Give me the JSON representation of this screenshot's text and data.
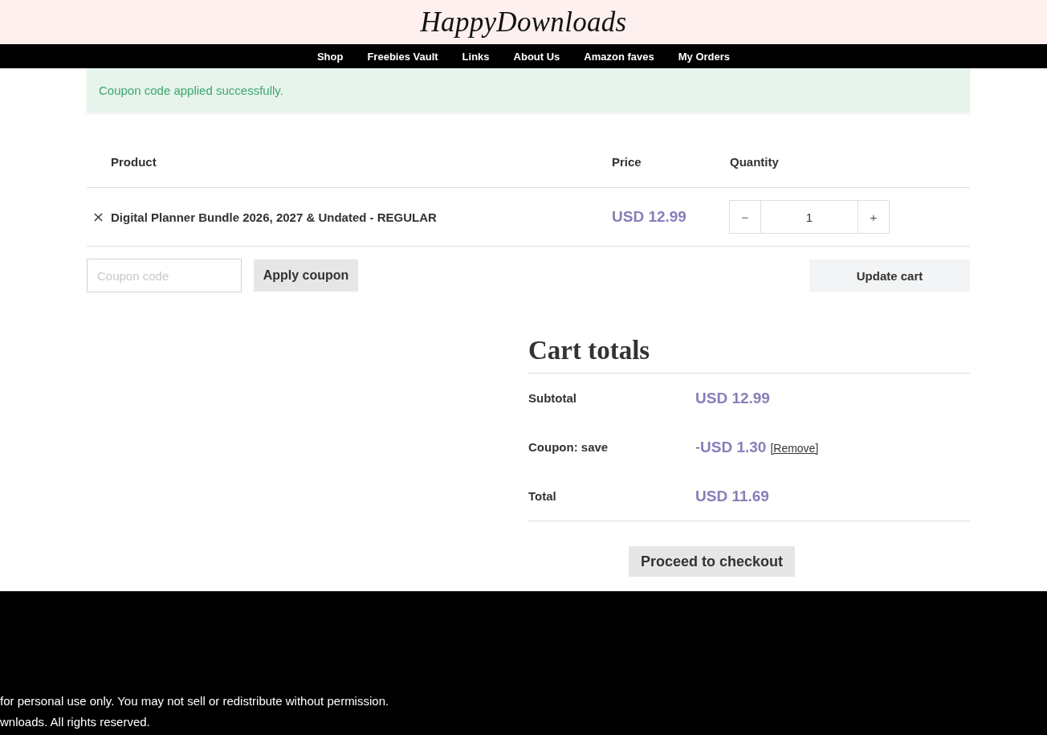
{
  "header": {
    "logo": "HappyDownloads"
  },
  "nav": {
    "items": [
      "Shop",
      "Freebies Vault",
      "Links",
      "About Us",
      "Amazon faves",
      "My Orders"
    ]
  },
  "notice": {
    "message": "Coupon code applied successfully."
  },
  "cart_table": {
    "columns": [
      "Product",
      "Price",
      "Quantity"
    ],
    "rows": [
      {
        "product": "Digital Planner Bundle 2026, 2027 & Undated - REGULAR",
        "price": "USD 12.99",
        "quantity": "1",
        "decrement": "−",
        "increment": "+"
      }
    ]
  },
  "coupon": {
    "placeholder": "Coupon code",
    "apply_button": "Apply coupon"
  },
  "update_button": "Update cart",
  "cart_totals": {
    "title": "Cart totals",
    "rows": [
      {
        "kind": "amount",
        "label": "Subtotal",
        "value": "USD 12.99"
      },
      {
        "kind": "discount",
        "label": "Coupon: save",
        "sign": "-",
        "value": "USD 1.30",
        "action": "[Remove]"
      },
      {
        "kind": "amount",
        "label": "Total",
        "value": "USD 11.69"
      }
    ],
    "checkout_button": "Proceed to checkout"
  },
  "footer": {
    "lines": [
      "for personal use only. You may not sell or redistribute without permission.",
      "wnloads. All rights reserved."
    ]
  }
}
